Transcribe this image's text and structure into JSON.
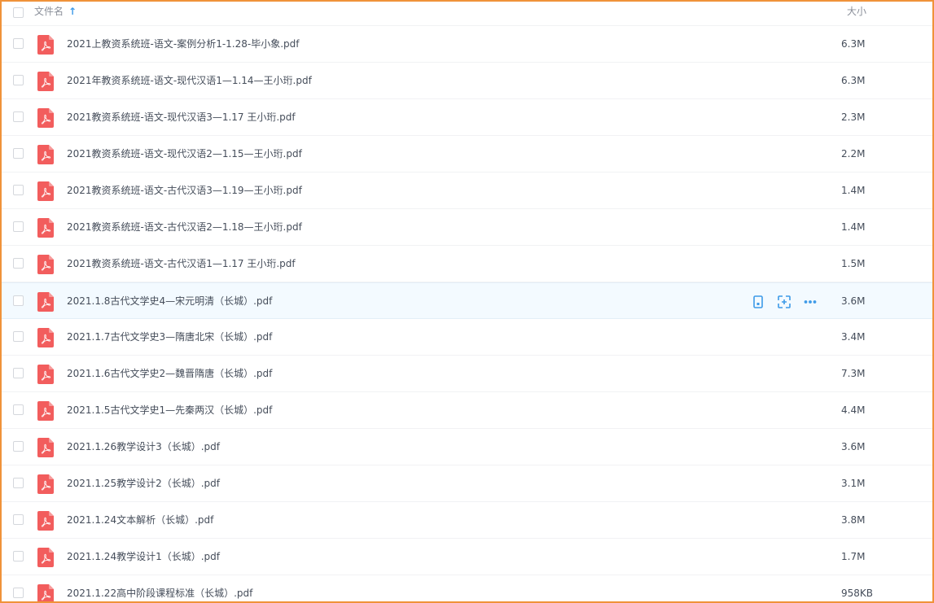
{
  "header": {
    "name_label": "文件名",
    "sort_arrow": "↑",
    "size_label": "大小"
  },
  "files": [
    {
      "name": "2021上教资系统班-语文-案例分析1-1.28-毕小象.pdf",
      "size": "6.3M"
    },
    {
      "name": "2021年教资系统班-语文-现代汉语1—1.14—王小珩.pdf",
      "size": "6.3M"
    },
    {
      "name": "2021教资系统班-语文-现代汉语3—1.17 王小珩.pdf",
      "size": "2.3M"
    },
    {
      "name": "2021教资系统班-语文-现代汉语2—1.15—王小珩.pdf",
      "size": "2.2M"
    },
    {
      "name": "2021教资系统班-语文-古代汉语3—1.19—王小珩.pdf",
      "size": "1.4M"
    },
    {
      "name": "2021教资系统班-语文-古代汉语2—1.18—王小珩.pdf",
      "size": "1.4M"
    },
    {
      "name": "2021教资系统班-语文-古代汉语1—1.17 王小珩.pdf",
      "size": "1.5M"
    },
    {
      "name": "2021.1.8古代文学史4—宋元明清（长城）.pdf",
      "size": "3.6M"
    },
    {
      "name": "2021.1.7古代文学史3—隋唐北宋（长城）.pdf",
      "size": "3.4M"
    },
    {
      "name": "2021.1.6古代文学史2—魏晋隋唐（长城）.pdf",
      "size": "7.3M"
    },
    {
      "name": "2021.1.5古代文学史1—先秦两汉（长城）.pdf",
      "size": "4.4M"
    },
    {
      "name": "2021.1.26教学设计3（长城）.pdf",
      "size": "3.6M"
    },
    {
      "name": "2021.1.25教学设计2（长城）.pdf",
      "size": "3.1M"
    },
    {
      "name": "2021.1.24文本解析（长城）.pdf",
      "size": "3.8M"
    },
    {
      "name": "2021.1.24教学设计1（长城）.pdf",
      "size": "1.7M"
    },
    {
      "name": "2021.1.22高中阶段课程标准（长城）.pdf",
      "size": "958KB"
    }
  ],
  "hover_row_index": 7,
  "colors": {
    "accent": "#3d9ae8",
    "pdf_red": "#f25d5d",
    "frame_border": "#f0923a",
    "hover_bg": "#f3faff"
  },
  "icons": {
    "file": "pdf-file-icon",
    "actions": [
      "mobile-icon",
      "share-icon",
      "more-icon"
    ]
  }
}
